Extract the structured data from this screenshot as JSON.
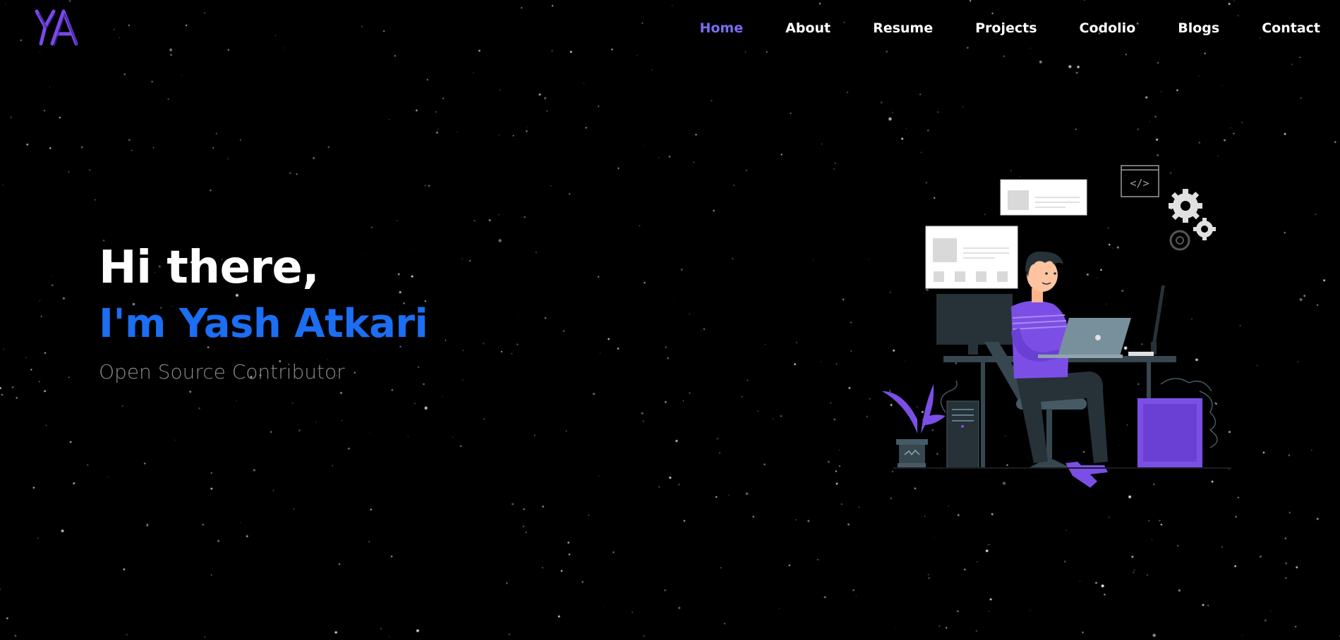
{
  "logo": {
    "text": "YA",
    "color": "#6f3fd8"
  },
  "nav": {
    "items": [
      {
        "label": "Home",
        "active": true
      },
      {
        "label": "About",
        "active": false
      },
      {
        "label": "Resume",
        "active": false
      },
      {
        "label": "Projects",
        "active": false
      },
      {
        "label": "Codolio",
        "active": false
      },
      {
        "label": "Blogs",
        "active": false
      },
      {
        "label": "Contact",
        "active": false
      }
    ],
    "active_color": "#7b6cf0",
    "text_color": "#ffffff"
  },
  "hero": {
    "greeting": "Hi there,",
    "name": "I'm Yash Atkari",
    "role": "Open Source Contributor",
    "name_color": "#1c6ef2"
  },
  "illustration": {
    "code_icon": "</>",
    "accent": "#7b4fe6",
    "dark": "#263238"
  },
  "background": {
    "color": "#000000"
  }
}
